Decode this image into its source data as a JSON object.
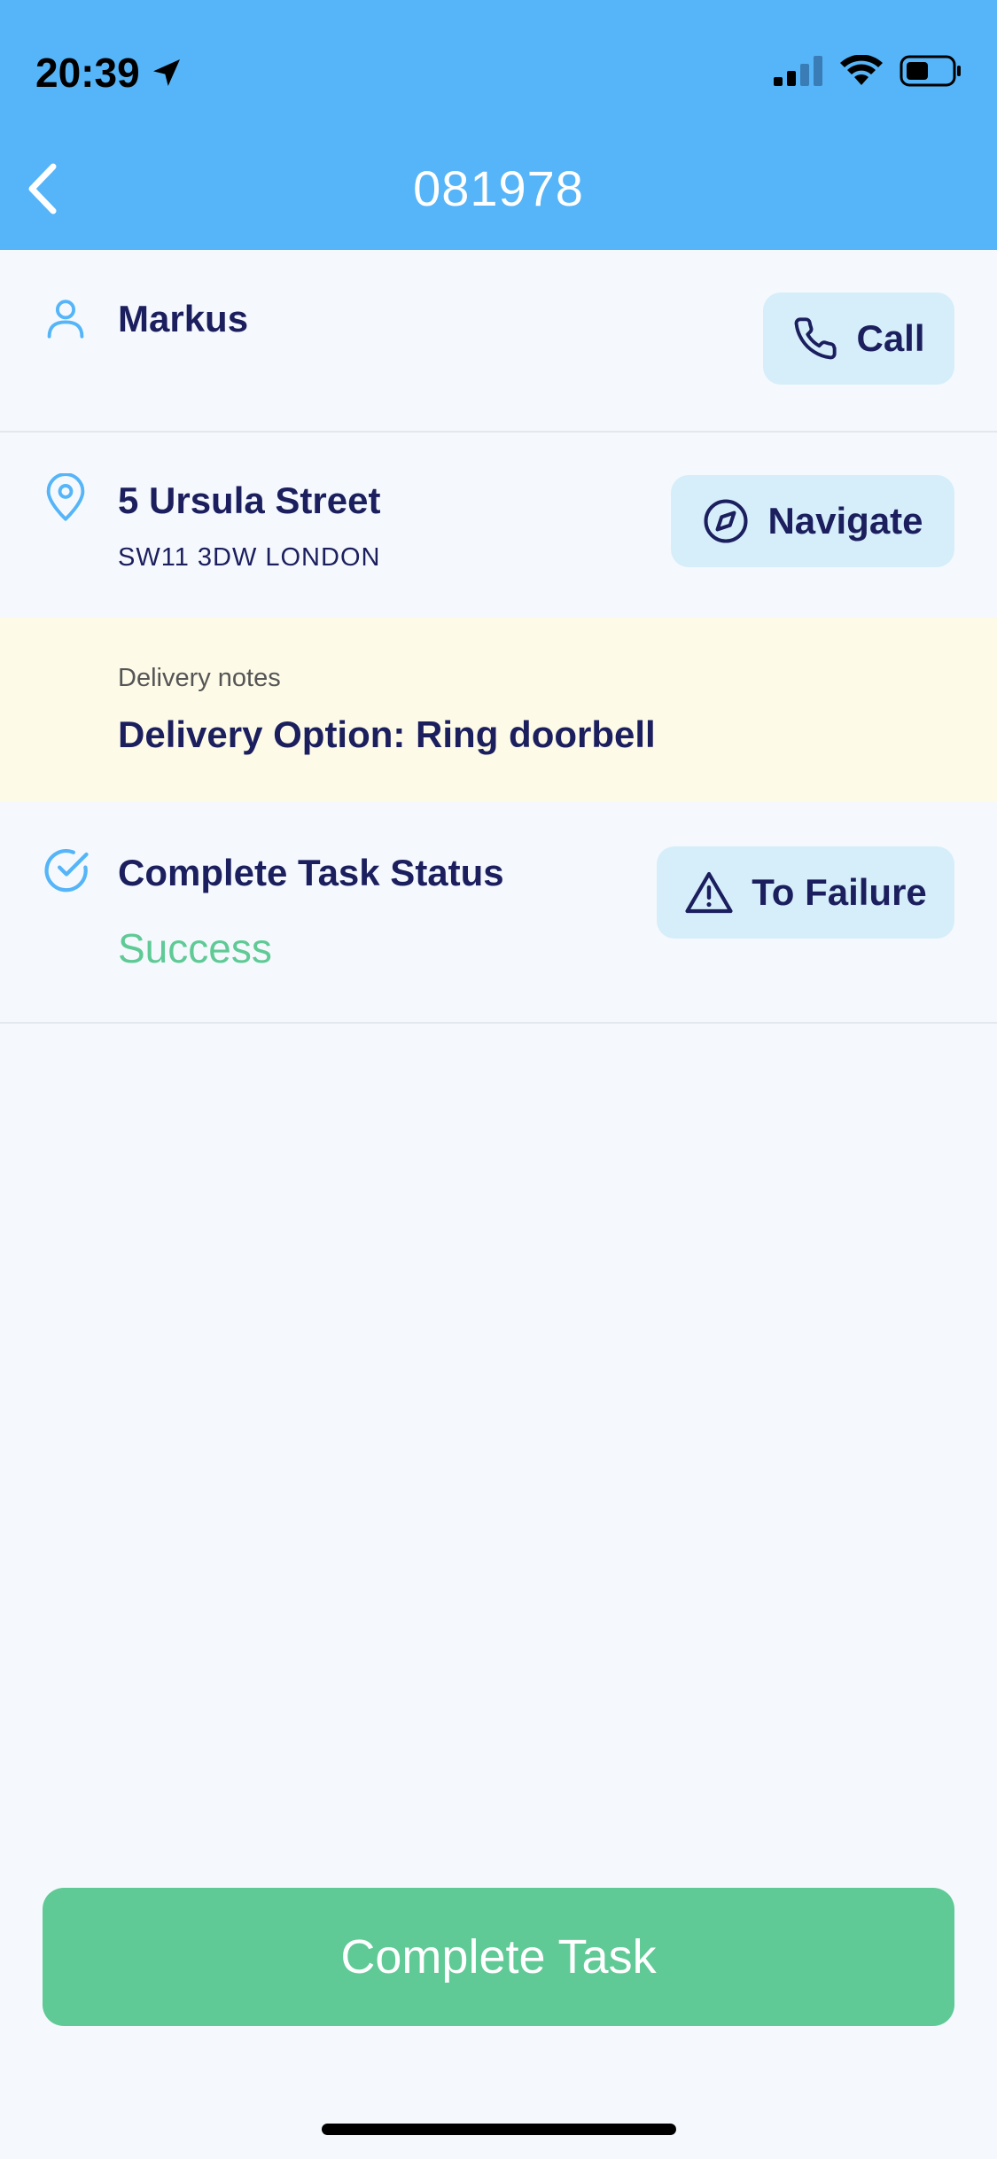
{
  "status_bar": {
    "time": "20:39"
  },
  "header": {
    "title": "081978"
  },
  "customer": {
    "name": "Markus",
    "call_label": "Call"
  },
  "address": {
    "street": "5 Ursula Street",
    "postcode_city": "SW11 3DW LONDON",
    "navigate_label": "Navigate"
  },
  "notes": {
    "label": "Delivery notes",
    "text": "Delivery Option: Ring doorbell"
  },
  "task_status": {
    "title": "Complete Task Status",
    "value": "Success",
    "failure_label": "To Failure"
  },
  "footer": {
    "complete_label": "Complete Task"
  },
  "colors": {
    "header": "#55b5f8",
    "accent_text": "#1c1f5e",
    "success": "#5fca95",
    "button_bg": "#d6eefa",
    "notes_bg": "#fdfae8"
  }
}
